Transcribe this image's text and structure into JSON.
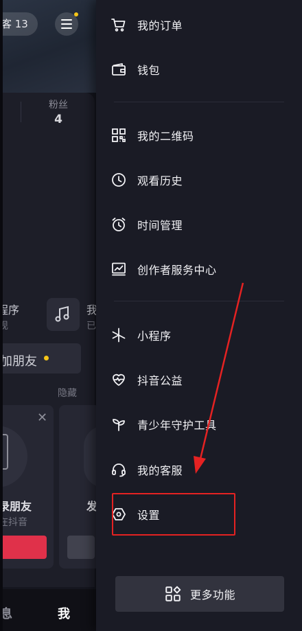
{
  "background_page": {
    "visitor_text": "客 13",
    "fans_label": "粉丝",
    "fans_value": "4",
    "mini_program_title": "程序",
    "mini_program_sub": "现",
    "music_title": "我",
    "music_sub": "已",
    "add_friend_label": "加朋友",
    "hide_label": "隐藏",
    "card1_title": "录朋友",
    "card1_sub": "在抖音",
    "card2_title": "发",
    "tab_message": "息",
    "tab_me": "我"
  },
  "drawer": {
    "items": [
      {
        "label": "我的订单",
        "icon": "cart-icon"
      },
      {
        "label": "钱包",
        "icon": "wallet-icon"
      },
      {
        "label": "我的二维码",
        "icon": "qr-code-icon"
      },
      {
        "label": "观看历史",
        "icon": "clock-icon"
      },
      {
        "label": "时间管理",
        "icon": "alarm-clock-icon"
      },
      {
        "label": "创作者服务中心",
        "icon": "chart-icon"
      },
      {
        "label": "小程序",
        "icon": "asterisk-icon"
      },
      {
        "label": "抖音公益",
        "icon": "heart-icon"
      },
      {
        "label": "青少年守护工具",
        "icon": "sprout-icon"
      },
      {
        "label": "我的客服",
        "icon": "headset-icon"
      },
      {
        "label": "设置",
        "icon": "hexagon-settings-icon"
      }
    ],
    "more_button": {
      "label": "更多功能",
      "icon": "grid-icon"
    }
  },
  "colors": {
    "drawer_bg": "#1a1b25",
    "highlight": "#e52222",
    "notification_dot": "#f5c518",
    "accent_red": "#e0314a"
  }
}
